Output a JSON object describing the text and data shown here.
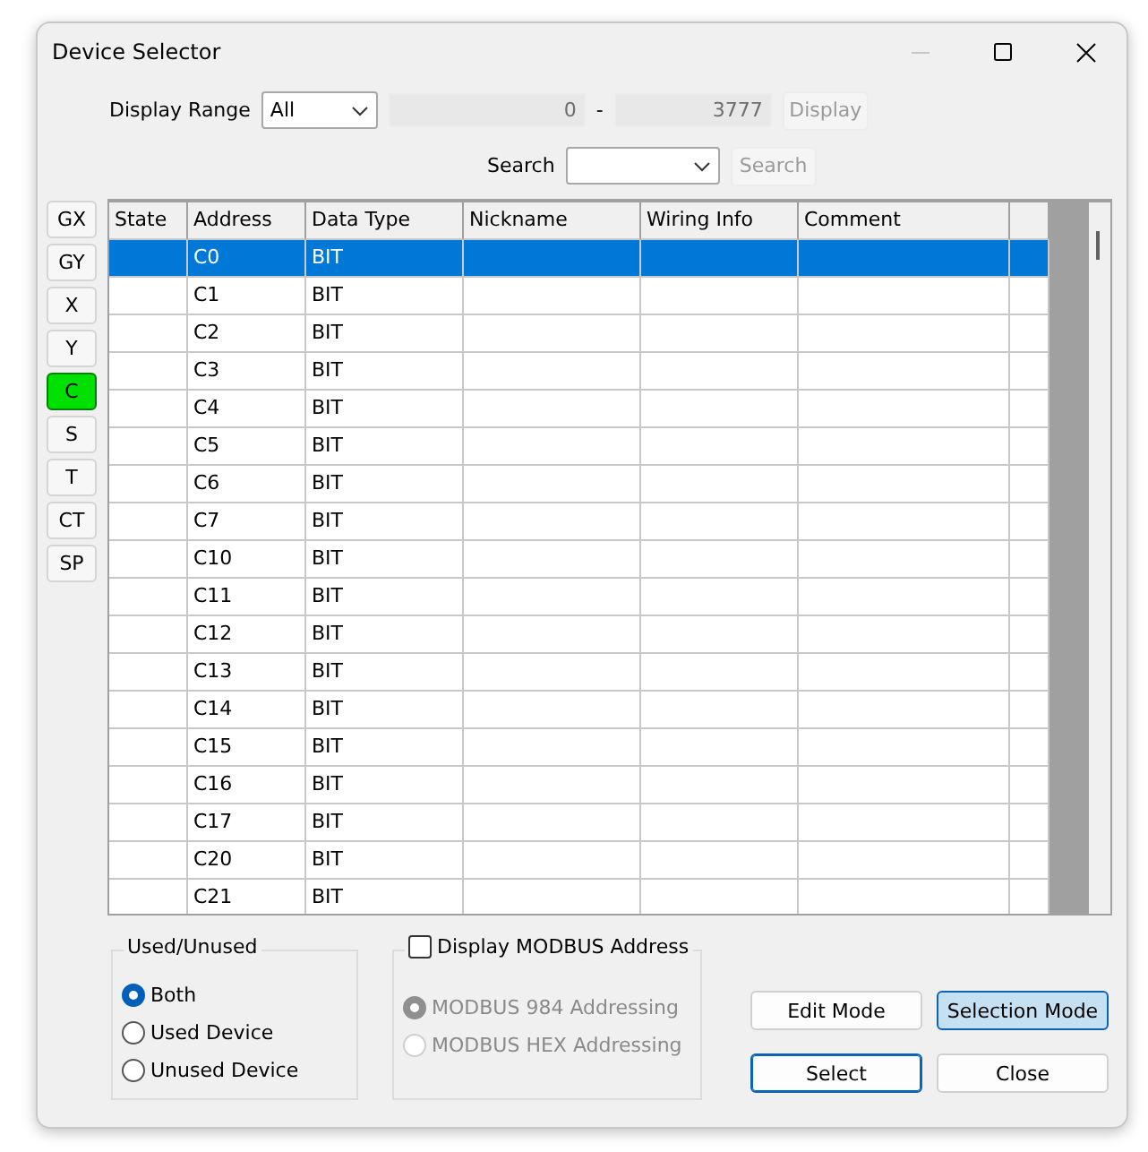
{
  "window": {
    "title": "Device Selector",
    "minimize_disabled": true
  },
  "display_range": {
    "label": "Display Range",
    "value": "All",
    "start": "0",
    "separator": "-",
    "end": "3777",
    "button": "Display",
    "button_disabled": true
  },
  "search": {
    "label": "Search",
    "button": "Search",
    "button_disabled": true
  },
  "device_types": [
    {
      "label": "GX",
      "selected": false
    },
    {
      "label": "GY",
      "selected": false
    },
    {
      "label": "X",
      "selected": false
    },
    {
      "label": "Y",
      "selected": false
    },
    {
      "label": "C",
      "selected": true
    },
    {
      "label": "S",
      "selected": false
    },
    {
      "label": "T",
      "selected": false
    },
    {
      "label": "CT",
      "selected": false
    },
    {
      "label": "SP",
      "selected": false
    }
  ],
  "table": {
    "columns": [
      "State",
      "Address",
      "Data Type",
      "Nickname",
      "Wiring Info",
      "Comment"
    ],
    "rows": [
      {
        "address": "C0",
        "data_type": "BIT",
        "selected": true
      },
      {
        "address": "C1",
        "data_type": "BIT",
        "selected": false
      },
      {
        "address": "C2",
        "data_type": "BIT",
        "selected": false
      },
      {
        "address": "C3",
        "data_type": "BIT",
        "selected": false
      },
      {
        "address": "C4",
        "data_type": "BIT",
        "selected": false
      },
      {
        "address": "C5",
        "data_type": "BIT",
        "selected": false
      },
      {
        "address": "C6",
        "data_type": "BIT",
        "selected": false
      },
      {
        "address": "C7",
        "data_type": "BIT",
        "selected": false
      },
      {
        "address": "C10",
        "data_type": "BIT",
        "selected": false
      },
      {
        "address": "C11",
        "data_type": "BIT",
        "selected": false
      },
      {
        "address": "C12",
        "data_type": "BIT",
        "selected": false
      },
      {
        "address": "C13",
        "data_type": "BIT",
        "selected": false
      },
      {
        "address": "C14",
        "data_type": "BIT",
        "selected": false
      },
      {
        "address": "C15",
        "data_type": "BIT",
        "selected": false
      },
      {
        "address": "C16",
        "data_type": "BIT",
        "selected": false
      },
      {
        "address": "C17",
        "data_type": "BIT",
        "selected": false
      },
      {
        "address": "C20",
        "data_type": "BIT",
        "selected": false
      },
      {
        "address": "C21",
        "data_type": "BIT",
        "selected": false
      }
    ]
  },
  "used_unused": {
    "title": "Used/Unused",
    "options": [
      {
        "label": "Both",
        "selected": true
      },
      {
        "label": "Used Device",
        "selected": false
      },
      {
        "label": "Unused Device",
        "selected": false
      }
    ]
  },
  "modbus": {
    "label": "Display MODBUS Address",
    "checked": false,
    "options": [
      {
        "label": "MODBUS 984 Addressing",
        "selected": true,
        "disabled": true
      },
      {
        "label": "MODBUS HEX Addressing",
        "selected": false,
        "disabled": true
      }
    ]
  },
  "mode_buttons": [
    {
      "label": "Edit Mode",
      "selected": false
    },
    {
      "label": "Selection Mode",
      "selected": true
    }
  ],
  "action_buttons": [
    {
      "label": "Select",
      "kind": "default"
    },
    {
      "label": "Close",
      "kind": "normal"
    }
  ]
}
